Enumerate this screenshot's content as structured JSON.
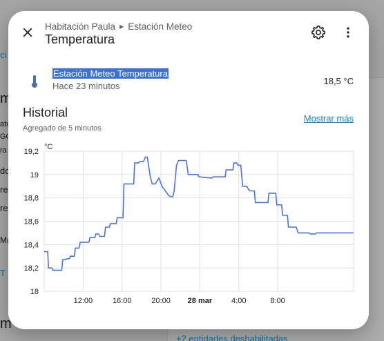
{
  "background": {
    "fragments": [
      "ci",
      "m",
      "atu",
      "GQ",
      "ra",
      "do",
      "re:",
      "re:",
      "M(",
      "T",
      "m"
    ],
    "footer_link": "+2 entidades deshabilitadas"
  },
  "dialog": {
    "breadcrumb": [
      "Habitación Paula",
      "Estación Meteo"
    ],
    "title": "Temperatura",
    "icons": {
      "close": "close-icon",
      "settings": "gear-icon",
      "more": "more-vert-icon",
      "entity": "thermometer-icon"
    },
    "entity": {
      "name": "Estación Meteo Temperatura",
      "updated": "Hace 23 minutos",
      "state": "18,5 °C"
    },
    "history": {
      "title": "Historial",
      "subtitle": "Agregado de 5 minutos",
      "show_more": "Mostrar más"
    }
  },
  "colors": {
    "line": "#4a72d8",
    "accent": "#0a87c7",
    "selection": "#3b71d6"
  },
  "chart_data": {
    "type": "line",
    "ylabel": "°C",
    "ylim": [
      18,
      19.2
    ],
    "yticks": [
      "18",
      "18,2",
      "18,4",
      "18,6",
      "18,8",
      "19",
      "19,2"
    ],
    "xlim": [
      0,
      15.9
    ],
    "xtick_positions": [
      2,
      4,
      6,
      8,
      10,
      12
    ],
    "xticks": [
      "12:00",
      "16:00",
      "20:00",
      "28 mar",
      "4:00",
      "8:00"
    ],
    "grid": true,
    "series": [
      {
        "x": [
          0,
          0.18,
          0.22,
          0.4,
          0.45,
          0.9,
          0.95,
          1.3,
          1.35,
          1.55,
          1.6,
          1.8,
          1.85,
          2.3,
          2.35,
          2.6,
          2.65,
          2.8,
          2.85,
          3.1,
          3.15,
          3.35,
          3.4,
          3.7,
          3.75,
          4.05,
          4.1,
          4.6,
          4.65,
          4.85,
          4.9,
          5.1,
          5.2,
          5.3,
          5.45,
          5.55,
          5.7,
          5.9,
          6.05,
          6.4,
          6.5,
          6.6,
          6.68,
          6.8,
          6.9,
          7.3,
          7.4,
          7.9,
          7.95,
          8.6,
          8.7,
          9.3,
          9.35,
          9.7,
          9.75,
          9.9,
          9.95,
          10.1,
          10.2,
          10.4,
          10.55,
          10.8,
          10.85,
          11.5,
          11.55,
          11.9,
          11.95,
          12.2,
          12.25,
          12.5,
          12.55,
          12.95,
          13.05,
          13.6,
          13.7,
          13.9,
          14.0,
          14.2,
          14.3,
          14.75,
          14.85,
          15.55,
          15.65,
          15.9
        ],
        "y": [
          18.34,
          18.34,
          18.2,
          18.2,
          18.18,
          18.18,
          18.27,
          18.28,
          18.3,
          18.3,
          18.37,
          18.37,
          18.42,
          18.42,
          18.46,
          18.46,
          18.49,
          18.49,
          18.47,
          18.47,
          18.55,
          18.55,
          18.58,
          18.58,
          18.63,
          18.63,
          18.92,
          18.92,
          19.1,
          19.1,
          19.11,
          19.11,
          19.15,
          19.15,
          18.98,
          18.92,
          18.92,
          18.97,
          18.9,
          18.82,
          18.81,
          18.81,
          18.86,
          19.08,
          19.12,
          19.12,
          19.0,
          19.0,
          18.98,
          18.97,
          18.98,
          18.98,
          19.04,
          19.04,
          19.1,
          19.1,
          19.08,
          19.08,
          18.9,
          18.9,
          18.86,
          18.86,
          18.76,
          18.76,
          18.84,
          18.84,
          18.74,
          18.74,
          18.65,
          18.65,
          18.55,
          18.55,
          18.5,
          18.5,
          18.49,
          18.49,
          18.5,
          18.5,
          18.5,
          18.5,
          18.5,
          18.5,
          18.5,
          18.5
        ]
      }
    ]
  }
}
